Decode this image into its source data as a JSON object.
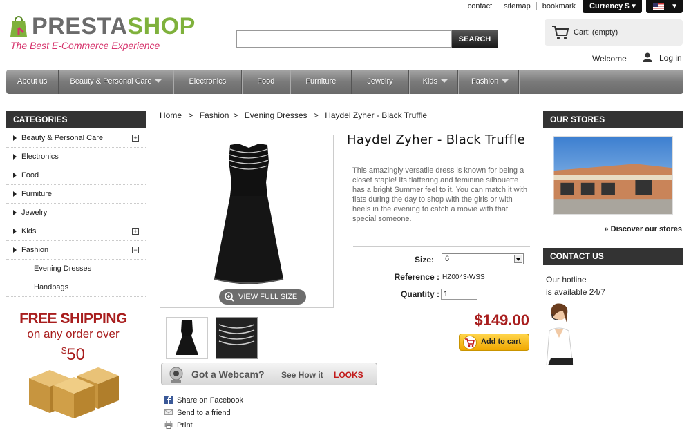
{
  "brand": {
    "name_part1": "PRESTA",
    "name_part2": "SHOP",
    "tagline": "The Best E-Commerce Experience"
  },
  "toplinks": [
    "contact",
    "sitemap",
    "bookmark"
  ],
  "currency": {
    "label": "Currency $"
  },
  "search": {
    "value": "",
    "button": "SEARCH"
  },
  "cart": {
    "label": "Cart: (empty)"
  },
  "account": {
    "welcome": "Welcome",
    "login": "Log in"
  },
  "nav": [
    {
      "label": "About us",
      "dropdown": false
    },
    {
      "label": "Beauty & Personal Care",
      "dropdown": true
    },
    {
      "label": "Electronics",
      "dropdown": false
    },
    {
      "label": "Food",
      "dropdown": false
    },
    {
      "label": "Furniture",
      "dropdown": false
    },
    {
      "label": "Jewelry",
      "dropdown": false
    },
    {
      "label": "Kids",
      "dropdown": true
    },
    {
      "label": "Fashion",
      "dropdown": true
    }
  ],
  "categories": {
    "title": "CATEGORIES",
    "items": [
      {
        "label": "Beauty & Personal Care",
        "toggle": "+"
      },
      {
        "label": "Electronics",
        "toggle": ""
      },
      {
        "label": "Food",
        "toggle": ""
      },
      {
        "label": "Furniture",
        "toggle": ""
      },
      {
        "label": "Jewelry",
        "toggle": ""
      },
      {
        "label": "Kids",
        "toggle": "+"
      },
      {
        "label": "Fashion",
        "toggle": "−"
      }
    ],
    "subitems": [
      "Evening Dresses",
      "Handbags"
    ]
  },
  "promo": {
    "line1": "FREE SHIPPING",
    "line2": "on any order over",
    "currency": "$",
    "amount": "50"
  },
  "breadcrumb": [
    "Home",
    ">",
    "Fashion",
    ">",
    "Evening Dresses",
    ">",
    "Haydel Zyher - Black Truffle"
  ],
  "product": {
    "title": "Haydel Zyher - Black Truffle",
    "description": "This amazingly versatile dress is known for being a closet staple! Its flattering and feminine silhouette has a bright Summer feel to it. You can match it with flats during the day to shop with the girls or with heels in the evening to catch a movie with that special someone.",
    "view_full": "VIEW FULL SIZE",
    "size_label": "Size:",
    "size_value": "6",
    "reference_label": "Reference :",
    "reference_value": "HZ0043-WSS",
    "quantity_label": "Quantity :",
    "quantity_value": "1",
    "price": "$149.00",
    "add_to_cart": "Add to cart"
  },
  "webcam": {
    "part1": "Got a Webcam?",
    "part2": "See How it",
    "part3": "LOOKS"
  },
  "share": [
    "Share on Facebook",
    "Send to a friend",
    "Print"
  ],
  "stores": {
    "title": "OUR STORES",
    "link": "» Discover our stores"
  },
  "contact": {
    "title": "CONTACT US",
    "line1": "Our hotline",
    "line2": "is available 24/7"
  },
  "colors": {
    "accent_green": "#7fb13c",
    "price_red": "#a81d1d",
    "tagline_pink": "#d6336c",
    "header_dark": "#333333"
  }
}
